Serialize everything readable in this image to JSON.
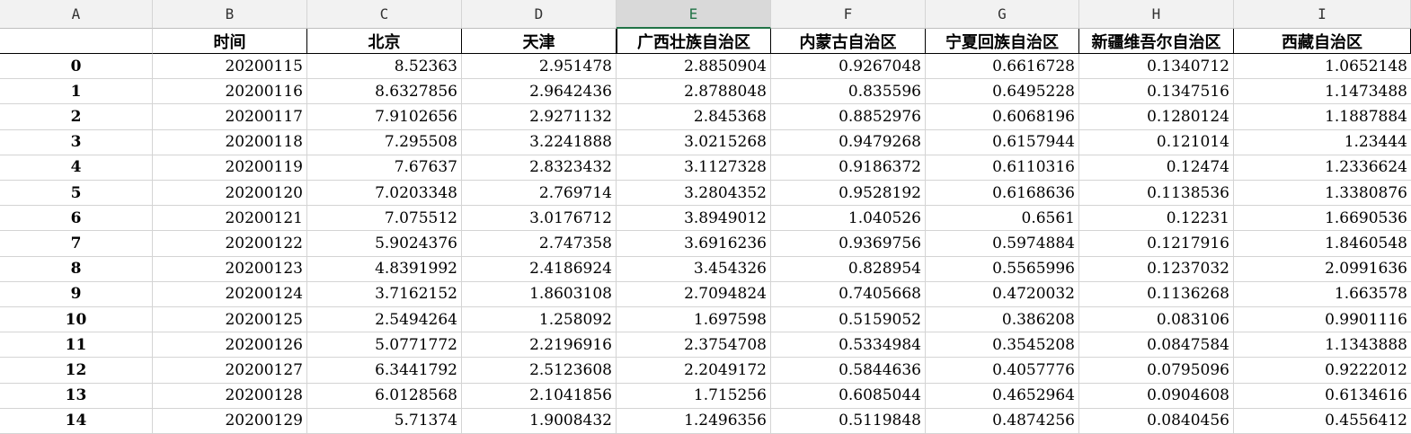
{
  "column_letters": [
    "A",
    "B",
    "C",
    "D",
    "E",
    "F",
    "G",
    "H",
    "I"
  ],
  "selected_column": 4,
  "headers": [
    "",
    "时间",
    "北京",
    "天津",
    "广西壮族自治区",
    "内蒙古自治区",
    "宁夏回族自治区",
    "新疆维吾尔自治区",
    "西藏自治区"
  ],
  "rows": [
    [
      "0",
      "20200115",
      "8.52363",
      "2.951478",
      "2.8850904",
      "0.9267048",
      "0.6616728",
      "0.1340712",
      "1.0652148"
    ],
    [
      "1",
      "20200116",
      "8.6327856",
      "2.9642436",
      "2.8788048",
      "0.835596",
      "0.6495228",
      "0.1347516",
      "1.1473488"
    ],
    [
      "2",
      "20200117",
      "7.9102656",
      "2.9271132",
      "2.845368",
      "0.8852976",
      "0.6068196",
      "0.1280124",
      "1.1887884"
    ],
    [
      "3",
      "20200118",
      "7.295508",
      "3.2241888",
      "3.0215268",
      "0.9479268",
      "0.6157944",
      "0.121014",
      "1.23444"
    ],
    [
      "4",
      "20200119",
      "7.67637",
      "2.8323432",
      "3.1127328",
      "0.9186372",
      "0.6110316",
      "0.12474",
      "1.2336624"
    ],
    [
      "5",
      "20200120",
      "7.0203348",
      "2.769714",
      "3.2804352",
      "0.9528192",
      "0.6168636",
      "0.1138536",
      "1.3380876"
    ],
    [
      "6",
      "20200121",
      "7.075512",
      "3.0176712",
      "3.8949012",
      "1.040526",
      "0.6561",
      "0.12231",
      "1.6690536"
    ],
    [
      "7",
      "20200122",
      "5.9024376",
      "2.747358",
      "3.6916236",
      "0.9369756",
      "0.5974884",
      "0.1217916",
      "1.8460548"
    ],
    [
      "8",
      "20200123",
      "4.8391992",
      "2.4186924",
      "3.454326",
      "0.828954",
      "0.5565996",
      "0.1237032",
      "2.0991636"
    ],
    [
      "9",
      "20200124",
      "3.7162152",
      "1.8603108",
      "2.7094824",
      "0.7405668",
      "0.4720032",
      "0.1136268",
      "1.663578"
    ],
    [
      "10",
      "20200125",
      "2.5494264",
      "1.258092",
      "1.697598",
      "0.5159052",
      "0.386208",
      "0.083106",
      "0.9901116"
    ],
    [
      "11",
      "20200126",
      "5.0771772",
      "2.2196916",
      "2.3754708",
      "0.5334984",
      "0.3545208",
      "0.0847584",
      "1.1343888"
    ],
    [
      "12",
      "20200127",
      "6.3441792",
      "2.5123608",
      "2.2049172",
      "0.5844636",
      "0.4057776",
      "0.0795096",
      "0.9222012"
    ],
    [
      "13",
      "20200128",
      "6.0128568",
      "2.1041856",
      "1.715256",
      "0.6085044",
      "0.4652964",
      "0.0904608",
      "0.6134616"
    ],
    [
      "14",
      "20200129",
      "5.71374",
      "1.9008432",
      "1.2496356",
      "0.5119848",
      "0.4874256",
      "0.0840456",
      "0.4556412"
    ]
  ]
}
